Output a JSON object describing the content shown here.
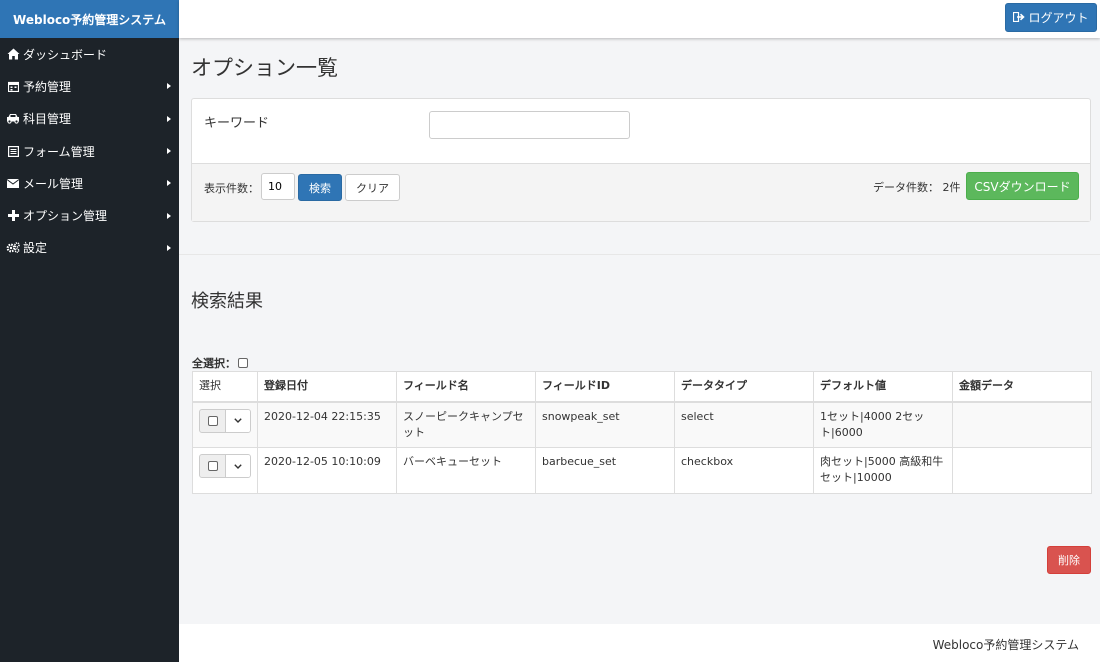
{
  "app": {
    "brand": "Webloco予約管理システム"
  },
  "sidebar": {
    "items": [
      {
        "label": "ダッシュボード",
        "icon": "home-icon",
        "has_submenu": false
      },
      {
        "label": "予約管理",
        "icon": "calendar-icon",
        "has_submenu": true
      },
      {
        "label": "科目管理",
        "icon": "car-icon",
        "has_submenu": true
      },
      {
        "label": "フォーム管理",
        "icon": "form-icon",
        "has_submenu": true
      },
      {
        "label": "メール管理",
        "icon": "envelope-icon",
        "has_submenu": true
      },
      {
        "label": "オプション管理",
        "icon": "plus-icon",
        "has_submenu": true
      },
      {
        "label": "設定",
        "icon": "cogs-icon",
        "has_submenu": true
      }
    ]
  },
  "header": {
    "logout_label": "ログアウト",
    "logout_icon": "sign-out-icon"
  },
  "page": {
    "title": "オプション一覧"
  },
  "search": {
    "keyword_label": "キーワード",
    "keyword_value": "",
    "perpage_label": "表示件数：",
    "perpage_value": "10",
    "search_button": "検索",
    "clear_button": "クリア",
    "count_label": "データ件数： 2件",
    "csv_button": "CSVダウンロード"
  },
  "results": {
    "title": "検索結果",
    "select_all_label": "全選択：",
    "columns": [
      "選択",
      "登録日付",
      "フィールド名",
      "フィールドID",
      "データタイプ",
      "デフォルト値",
      "金額データ"
    ],
    "rows": [
      {
        "date": "2020-12-04 22:15:35",
        "field_name": "スノーピークキャンプセット",
        "field_id": "snowpeak_set",
        "data_type": "select",
        "default_value": "1セット|4000 2セット|6000",
        "amount": ""
      },
      {
        "date": "2020-12-05 10:10:09",
        "field_name": "バーベキューセット",
        "field_id": "barbecue_set",
        "data_type": "checkbox",
        "default_value": "肉セット|5000 高級和牛セット|10000",
        "amount": ""
      }
    ],
    "delete_button": "削除"
  },
  "footer": {
    "text": "Webloco予約管理システム"
  },
  "colors": {
    "sidebar_bg": "#1d2329",
    "primary": "#2f75b5",
    "success": "#5cb85c",
    "danger": "#d9534f"
  }
}
